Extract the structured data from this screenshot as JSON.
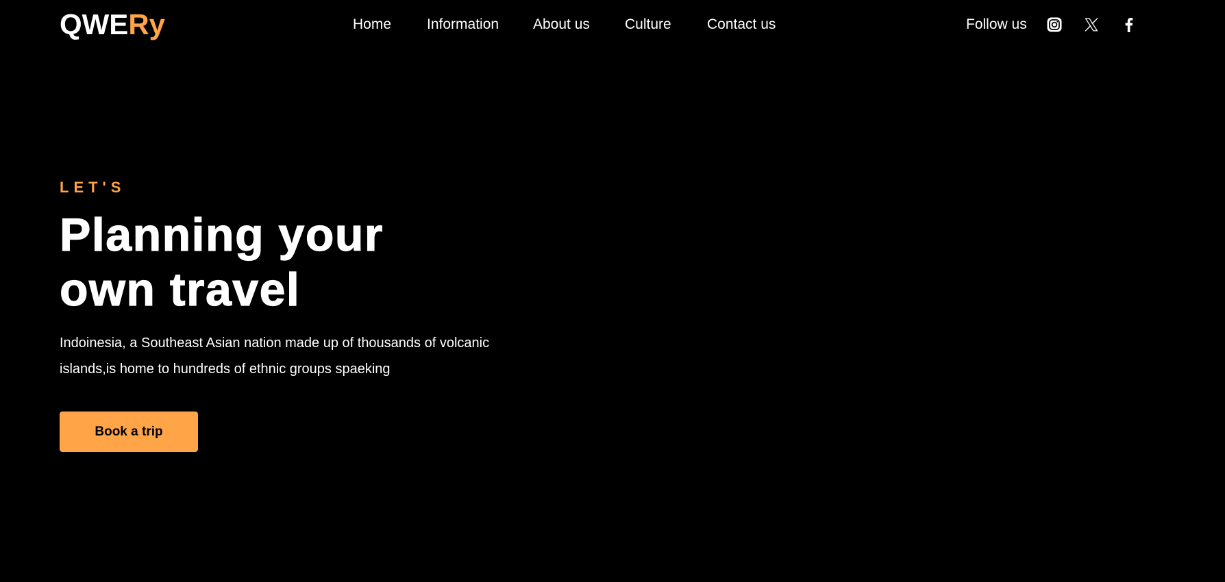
{
  "brand": {
    "logo_part1": "QWE",
    "logo_part2": "Ry",
    "accent_color": "#ffa447",
    "background_color": "#000000"
  },
  "nav": {
    "items": [
      {
        "label": "Home"
      },
      {
        "label": "Information"
      },
      {
        "label": "About us"
      },
      {
        "label": "Culture"
      },
      {
        "label": "Contact us"
      }
    ]
  },
  "social": {
    "label": "Follow us",
    "icons": [
      "instagram-icon",
      "x-icon",
      "facebook-icon"
    ]
  },
  "hero": {
    "eyebrow": "LET'S",
    "title_line1": "Planning your",
    "title_line2": "own travel",
    "description": "Indoinesia, a Southeast Asian nation made up of thousands of volcanic islands,is home to hundreds of ethnic groups spaeking",
    "cta_label": "Book a trip"
  }
}
